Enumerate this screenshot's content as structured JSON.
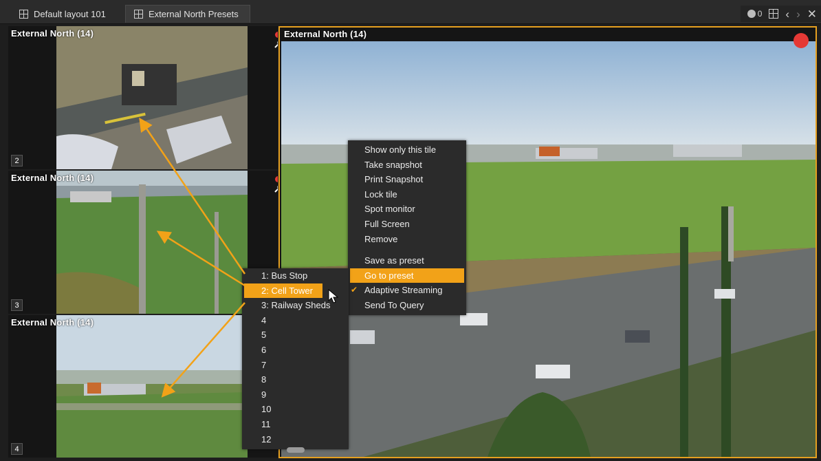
{
  "tabs": [
    {
      "label": "Default layout 101",
      "active": false
    },
    {
      "label": "External North Presets",
      "active": true
    }
  ],
  "toolbar": {
    "record_count": "0",
    "icons": [
      "record-dot-icon",
      "layout-grid-icon",
      "chevron-left-icon",
      "chevron-right-icon",
      "close-icon"
    ]
  },
  "tiles": [
    {
      "title": "External North (14)",
      "number": "2",
      "scene": "Bus Stop"
    },
    {
      "title": "External North (14)",
      "number": "3",
      "scene": "Cell Tower"
    },
    {
      "title": "External North (14)",
      "number": "4",
      "scene": "Railway Sheds"
    }
  ],
  "main_tile": {
    "title": "External North (14)"
  },
  "context_menu": {
    "items": [
      {
        "label": "Show only this tile"
      },
      {
        "label": "Take snapshot"
      },
      {
        "label": "Print Snapshot"
      },
      {
        "label": "Lock tile"
      },
      {
        "label": "Spot monitor"
      },
      {
        "label": "Full Screen"
      },
      {
        "label": "Remove"
      },
      {
        "label": "Save as preset"
      },
      {
        "label": "Go to preset",
        "highlighted": true
      },
      {
        "label": "Adaptive Streaming",
        "checked": true
      },
      {
        "label": "Send To Query"
      }
    ]
  },
  "preset_menu": {
    "items": [
      {
        "label": "1: Bus Stop"
      },
      {
        "label": "2: Cell Tower",
        "highlighted": true
      },
      {
        "label": "3: Railway Sheds"
      },
      {
        "label": "4"
      },
      {
        "label": "5"
      },
      {
        "label": "6"
      },
      {
        "label": "7"
      },
      {
        "label": "8"
      },
      {
        "label": "9"
      },
      {
        "label": "10"
      },
      {
        "label": "11"
      },
      {
        "label": "12"
      }
    ]
  },
  "colors": {
    "accent": "#f2a218",
    "record": "#e53935",
    "panel": "#2b2b2b"
  }
}
